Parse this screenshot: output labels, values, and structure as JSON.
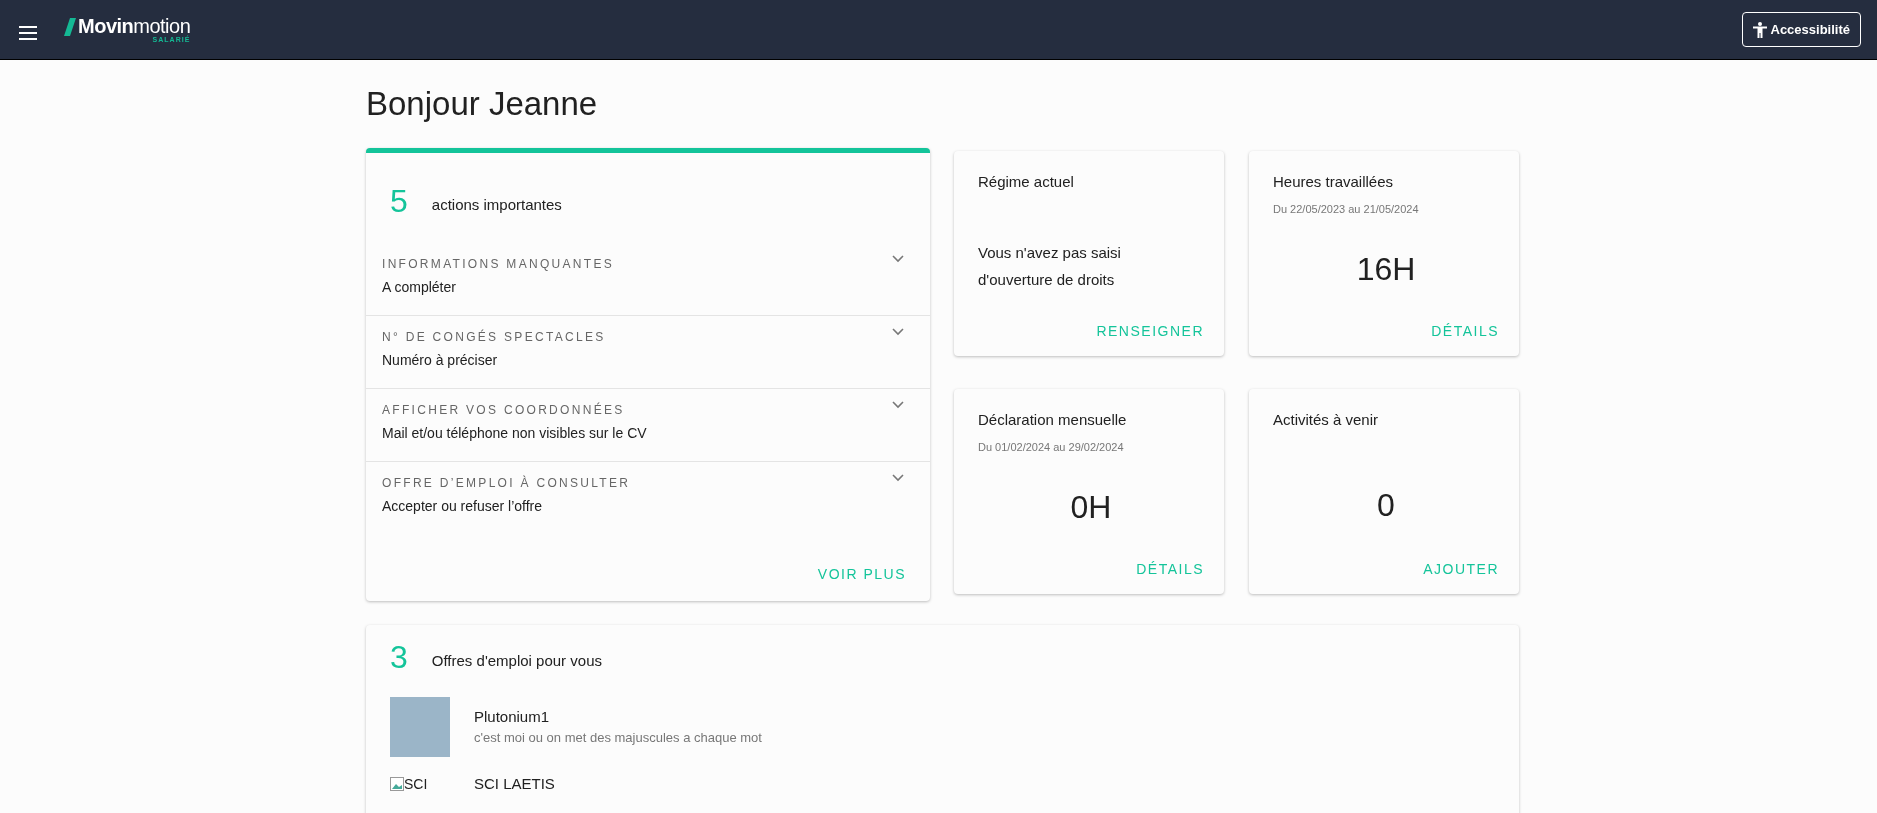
{
  "header": {
    "logo": "**Movin**motion",
    "logo_tag": "SALARIÉ",
    "accessibility_button": "Accessibilité"
  },
  "greeting": "Bonjour Jeanne",
  "actions": {
    "count": "5",
    "title": "actions importantes",
    "items": [
      {
        "label": "INFORMATIONS MANQUANTES",
        "detail": "A compléter",
        "expanded": false
      },
      {
        "label": "N° DE CONGÉS SPECTACLES",
        "detail": "Numéro à préciser",
        "expanded": false
      },
      {
        "label": "AFFICHER VOS COORDONNÉES",
        "detail": "Mail et/ou téléphone non visibles sur le CV",
        "expanded": false
      },
      {
        "label": "OFFRE D’EMPLOI À CONSULTER",
        "detail": "Accepter ou refuser l’offre",
        "expanded": false
      }
    ],
    "more_link": "VOIR PLUS"
  },
  "tiles": [
    {
      "kind": "text",
      "title": "Régime actuel",
      "body": "Vous n'avez pas saisi d'ouverture de droits",
      "action": "RENSEIGNER"
    },
    {
      "kind": "value",
      "title": "Heures travaillées",
      "period": "Du 22/05/2023 au 21/05/2024",
      "value": "16H",
      "action": "DÉTAILS"
    },
    {
      "kind": "value",
      "title": "Déclaration mensuelle",
      "period": "Du 01/02/2024 au 29/02/2024",
      "value": "0H",
      "action": "DÉTAILS"
    },
    {
      "kind": "value",
      "title": "Activités à venir",
      "value": "0",
      "action": "AJOUTER"
    }
  ],
  "jobs": {
    "count": "3",
    "title": "Offres d'emploi pour vous",
    "items": [
      {
        "kind": "photo",
        "name": "Plutonium1",
        "description": "c'est moi ou on met des majuscules a chaque mot"
      },
      {
        "kind": "broken",
        "image_alt": "SCI",
        "name": "SCI LAETIS"
      }
    ]
  }
}
